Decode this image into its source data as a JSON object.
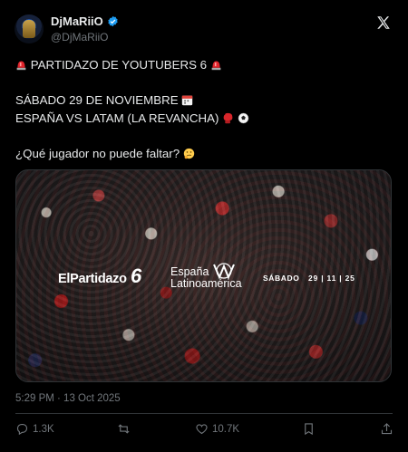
{
  "author": {
    "display_name": "DjMaRiiO",
    "handle": "@DjMaRiiO",
    "verified": true
  },
  "tweet": {
    "line1": "PARTIDAZO DE YOUTUBERS 6",
    "line2": "SÁBADO 29 DE NOVIEMBRE",
    "line3": "ESPAÑA VS LATAM (LA REVANCHA)",
    "line4": "¿Qué jugador no puede faltar?",
    "emojis": [
      "siren-emoji",
      "calendar-emoji",
      "boxing-glove-emoji",
      "soccer-ball-emoji",
      "thinking-face-emoji"
    ]
  },
  "media": {
    "brand": "ElPartidazo",
    "brand_number": "6",
    "team_a": "España",
    "team_b": "Latinoamérica",
    "day": "SÁBADO",
    "date": "29 | 11 | 25"
  },
  "meta": {
    "timestamp": "5:29 PM · 13 Oct 2025"
  },
  "actions": {
    "replies": "1.3K",
    "likes": "10.7K"
  },
  "colors": {
    "background": "#000000",
    "text": "#e7e9ea",
    "muted": "#71767b",
    "verified": "#1d9bf0",
    "border": "#2f3336"
  }
}
